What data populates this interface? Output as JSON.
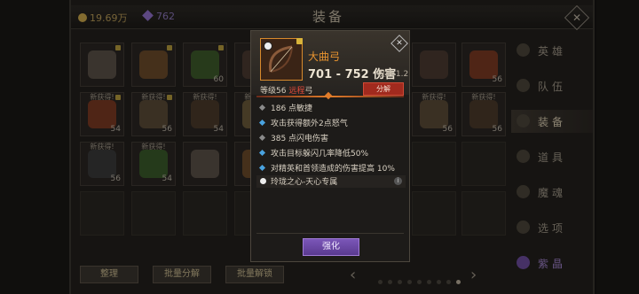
{
  "header": {
    "title": "装备",
    "gold": "19.69万",
    "gems": "762"
  },
  "grid": {
    "rows": [
      [
        {
          "level": "",
          "new": "",
          "lock": true
        },
        {
          "level": "",
          "new": "",
          "lock": true
        },
        {
          "level": "60",
          "new": "",
          "lock": true
        },
        {
          "level": "",
          "new": "",
          "lock": true
        }
      ],
      [
        {
          "level": "54",
          "new": "新获得!",
          "lock": true
        },
        {
          "level": "56",
          "new": "新获得!",
          "lock": true
        },
        {
          "level": "54",
          "new": "新获得!",
          "lock": false
        },
        {
          "level": "54",
          "new": "新获得!",
          "lock": true
        }
      ],
      [
        {
          "level": "56",
          "new": "新获得!",
          "lock": false
        },
        {
          "level": "54",
          "new": "新获得!",
          "lock": false
        },
        {
          "level": "",
          "new": "",
          "lock": false
        },
        {
          "level": "",
          "new": "",
          "lock": false
        }
      ]
    ],
    "right_rows": [
      [
        {
          "level": "",
          "new": ""
        },
        {
          "level": "56",
          "new": ""
        }
      ],
      [
        {
          "level": "56",
          "new": "新获得!"
        },
        {
          "level": "56",
          "new": "新获得!"
        }
      ]
    ]
  },
  "sidebar": {
    "items": [
      {
        "label": "英雄"
      },
      {
        "label": "队伍"
      },
      {
        "label": "装备"
      },
      {
        "label": "道具"
      },
      {
        "label": "魔魂"
      },
      {
        "label": "选项"
      },
      {
        "label": "紫晶"
      }
    ]
  },
  "bottom": {
    "sort_label": "整理",
    "batch_decompose_label": "批量分解",
    "batch_unlock_label": "批量解锁"
  },
  "popup": {
    "name": "大曲弓",
    "damage": "701 - 752 伤害",
    "attack_speed": "攻速 1.2",
    "level_prefix": "等级56 ",
    "level_highlight": "远程",
    "level_suffix": "弓",
    "decompose_label": "分解",
    "stats": [
      {
        "text": "186 点敏捷",
        "color": "grey"
      },
      {
        "text": "攻击获得额外2点怒气",
        "color": "blue"
      },
      {
        "text": "385 点闪电伤害",
        "color": "grey"
      },
      {
        "text": "攻击目标躲闪几率降低50%",
        "color": "blue"
      },
      {
        "text": "对精英和首领造成的伤害提高 10%",
        "color": "blue"
      }
    ],
    "set_name": "玲珑之心-天心专属",
    "info_glyph": "i",
    "enhance_label": "强化"
  }
}
